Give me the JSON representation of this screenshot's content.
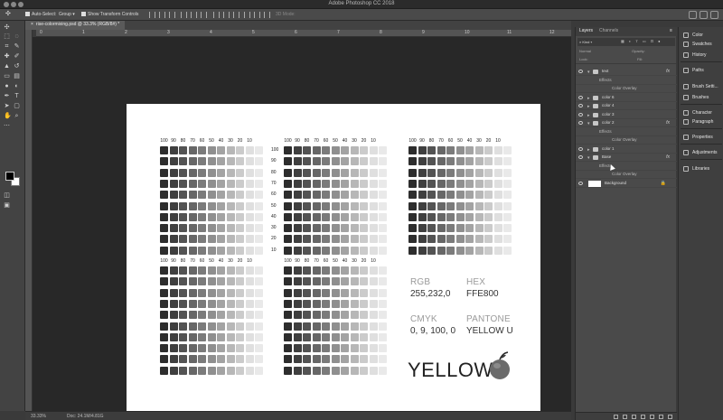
{
  "app": {
    "title": "Adobe Photoshop CC 2018"
  },
  "options_bar": {
    "auto_select_label": "Auto-Select:",
    "auto_select_value": "Group",
    "show_transform_label": "Show Transform Controls",
    "mode_3d_label": "3D Mode:"
  },
  "document_tab": {
    "label": "rise-colormixing.psd @ 33.3% (RGB/8#) *"
  },
  "rulers": {
    "top": [
      "0",
      "1",
      "2",
      "3",
      "4",
      "5",
      "6",
      "7",
      "8",
      "9",
      "10",
      "11",
      "12"
    ]
  },
  "status": {
    "zoom": "33.33%",
    "doc": "Doc: 24.1M/4.81G"
  },
  "swatch_sheet": {
    "scale_labels": [
      "100",
      "90",
      "80",
      "70",
      "60",
      "50",
      "40",
      "30",
      "20",
      "10"
    ],
    "row_labels": [
      "100",
      "90",
      "80",
      "70",
      "60",
      "50",
      "40",
      "30",
      "20",
      "10"
    ],
    "rgb_label": "RGB",
    "rgb_value": "255,232,0",
    "hex_label": "HEX",
    "hex_value": "FFE800",
    "cmyk_label": "CMYK",
    "cmyk_value": "0, 9, 100, 0",
    "pantone_label": "PANTONE",
    "pantone_value": "YELLOW U",
    "color_name": "YELLOW"
  },
  "layers_panel": {
    "tabs": [
      "Layers",
      "Channels"
    ],
    "kind_label": "Kind",
    "blend_mode": "Normal",
    "opacity_label": "Opacity:",
    "lock_label": "Lock:",
    "fill_label": "Fill:",
    "layers": [
      {
        "name": "text",
        "type": "group",
        "fx": "fx"
      },
      {
        "name": "Effects",
        "type": "effects"
      },
      {
        "name": "Color Overlay",
        "type": "effect"
      },
      {
        "name": "color 6",
        "type": "group"
      },
      {
        "name": "color 4",
        "type": "group"
      },
      {
        "name": "color 3",
        "type": "group"
      },
      {
        "name": "color 2",
        "type": "group",
        "fx": "fx"
      },
      {
        "name": "Effects",
        "type": "effects"
      },
      {
        "name": "Color Overlay",
        "type": "effect"
      },
      {
        "name": "color 1",
        "type": "group"
      },
      {
        "name": "Base",
        "type": "group",
        "fx": "fx"
      },
      {
        "name": "Effects",
        "type": "effects"
      },
      {
        "name": "Color Overlay",
        "type": "effect"
      },
      {
        "name": "Background",
        "type": "background"
      }
    ]
  },
  "dock": {
    "items": [
      "Color",
      "Swatches",
      "History",
      "Paths",
      "Brush Setti...",
      "Brushes",
      "Character",
      "Paragraph",
      "Properties",
      "Adjustments",
      "Libraries"
    ]
  }
}
